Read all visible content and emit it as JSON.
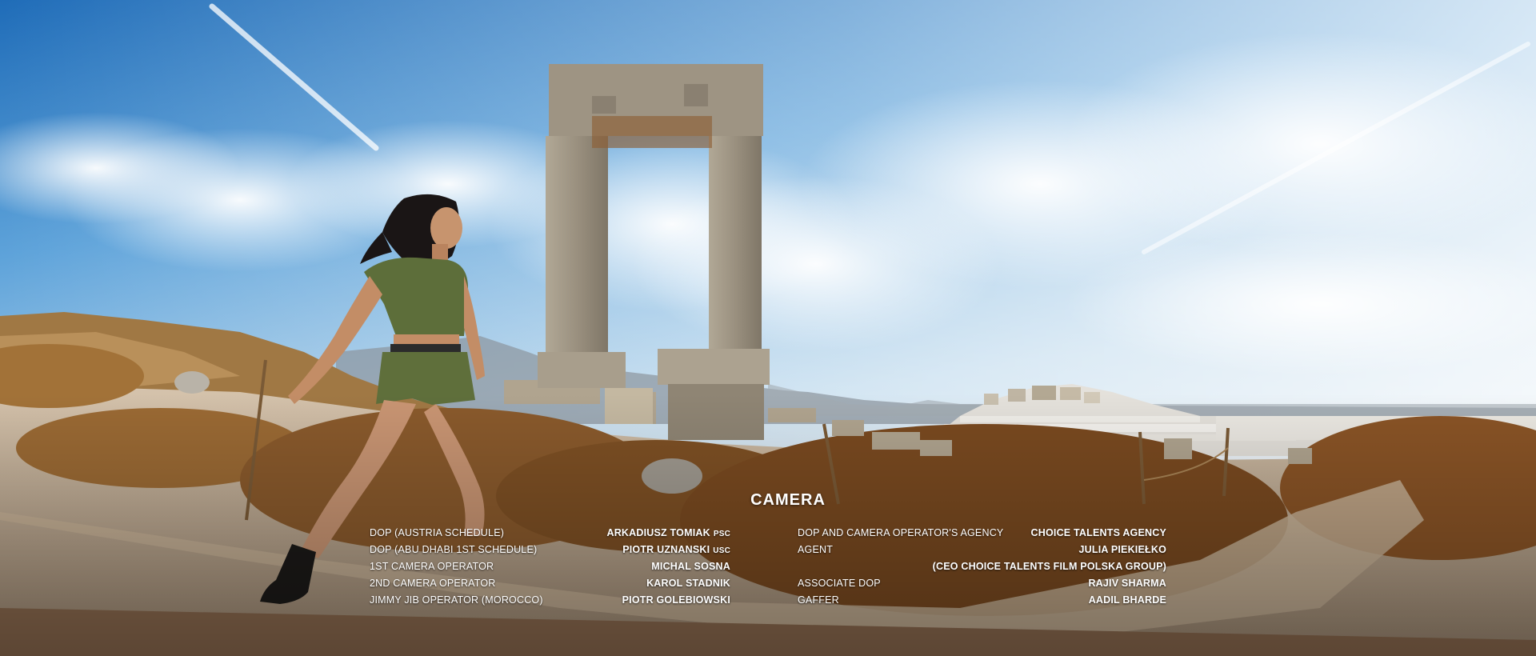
{
  "credits": {
    "heading": "CAMERA",
    "left_roles": [
      "DOP (AUSTRIA SCHEDULE)",
      "DOP (ABU DHABI 1ST SCHEDULE)",
      "1ST CAMERA OPERATOR",
      "2ND CAMERA OPERATOR",
      "JIMMY JIB OPERATOR (MOROCCO)"
    ],
    "left_names": [
      {
        "name": "ARKADIUSZ TOMIAK",
        "suffix": "PSC"
      },
      {
        "name": "PIOTR UZNANSKI",
        "suffix": "USC"
      },
      {
        "name": "MICHAL SOSNA",
        "suffix": ""
      },
      {
        "name": "KAROL STADNIK",
        "suffix": ""
      },
      {
        "name": "PIOTR GOLEBIOWSKI",
        "suffix": ""
      }
    ],
    "right_roles": [
      "DOP AND CAMERA OPERATOR'S AGENCY",
      "AGENT",
      "",
      "ASSOCIATE DOP",
      "GAFFER"
    ],
    "right_names": [
      "CHOICE TALENTS AGENCY",
      "JULIA PIEKIEŁKO",
      "(CEO CHOICE TALENTS FILM POLSKA GROUP)",
      "RAJIV SHARMA",
      "AADIL BHARDE"
    ]
  },
  "colors": {
    "sky_top": "#2f7fc8",
    "sky_mid": "#8ec1e6",
    "haze": "#dfe8ef",
    "ground": "#c9b39a",
    "brush": "#8a5a2c",
    "stone": "#9c9485",
    "outfit": "#5d6e3a",
    "text": "#ffffff"
  }
}
